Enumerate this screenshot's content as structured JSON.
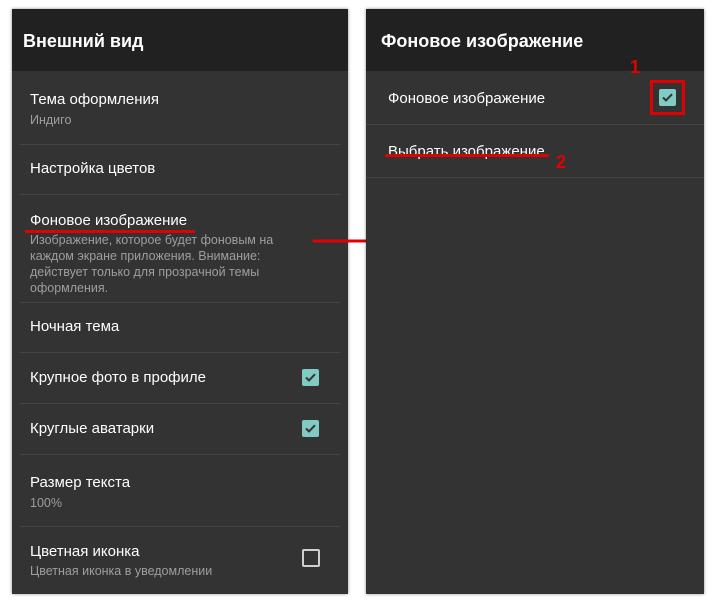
{
  "left_panel": {
    "header_title": "Внешний вид",
    "items": [
      {
        "title": "Тема оформления",
        "subtitle": "Индиго"
      },
      {
        "title": "Настройка цветов"
      },
      {
        "title": "Фоновое изображение",
        "subtitle": "Изображение, которое будет фоновым на каждом экране приложения. Внимание: действует только для прозрачной темы оформления."
      },
      {
        "title": "Ночная тема"
      },
      {
        "title": "Крупное фото в профиле",
        "checked": true
      },
      {
        "title": "Круглые аватарки",
        "checked": true
      },
      {
        "title": "Размер текста",
        "subtitle": "100%"
      },
      {
        "title": "Цветная иконка",
        "subtitle": "Цветная иконка в уведомлении",
        "checked": false
      }
    ]
  },
  "right_panel": {
    "header_title": "Фоновое изображение",
    "items": [
      {
        "title": "Фоновое изображение",
        "checked": true
      },
      {
        "title": "Выбрать изображение"
      }
    ]
  },
  "annotations": {
    "marker_1": "1",
    "marker_2": "2",
    "highlight_color": "#e30000",
    "accent_color": "#80cbc4"
  }
}
